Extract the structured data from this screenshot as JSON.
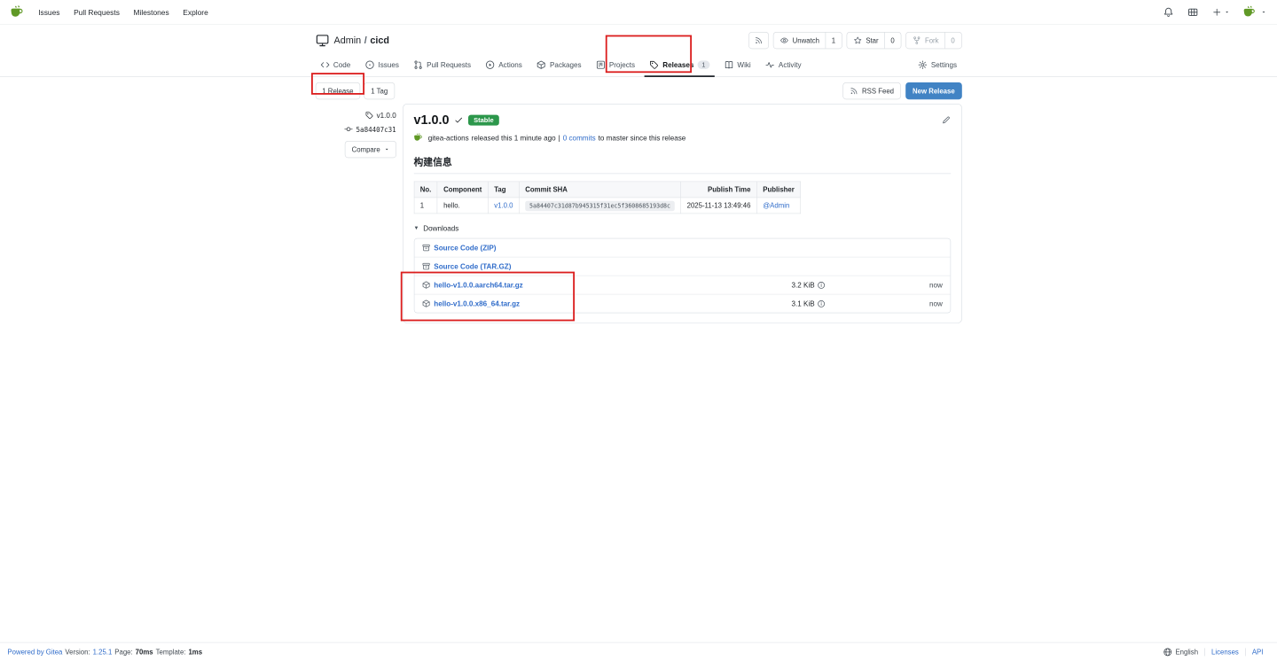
{
  "navbar": {
    "links": [
      "Issues",
      "Pull Requests",
      "Milestones",
      "Explore"
    ]
  },
  "repo": {
    "owner": "Admin",
    "separator": "/",
    "name": "cicd",
    "watch": {
      "label": "Unwatch",
      "count": "1"
    },
    "star": {
      "label": "Star",
      "count": "0"
    },
    "fork": {
      "label": "Fork",
      "count": "0"
    },
    "tabs": [
      {
        "label": "Code"
      },
      {
        "label": "Issues"
      },
      {
        "label": "Pull Requests"
      },
      {
        "label": "Actions"
      },
      {
        "label": "Packages"
      },
      {
        "label": "Projects"
      },
      {
        "label": "Releases",
        "count": "1"
      },
      {
        "label": "Wiki"
      },
      {
        "label": "Activity"
      },
      {
        "label": "Settings"
      }
    ]
  },
  "toolbar": {
    "releases_filter": "1 Release",
    "tags_filter": "1 Tag",
    "rss_feed": "RSS Feed",
    "new_release": "New Release"
  },
  "release_meta": {
    "tag": "v1.0.0",
    "commit": "5a84407c31",
    "compare_label": "Compare"
  },
  "release": {
    "title": "v1.0.0",
    "stability_badge": "Stable",
    "byline": {
      "author": "gitea-actions",
      "released_text": "released this 1 minute ago",
      "separator": "|",
      "commits_link": "0 commits",
      "suffix": "to master since this release"
    },
    "section_heading": "构建信息",
    "table": {
      "headers": [
        "No.",
        "Component",
        "Tag",
        "Commit SHA",
        "Publish Time",
        "Publisher"
      ],
      "rows": [
        [
          "1",
          "hello.",
          "v1.0.0",
          "5a84407c31d87b945315f31ec5f3608685193d8c",
          "2025-11-13 13:49:46",
          "@Admin"
        ]
      ]
    },
    "downloads_label": "Downloads",
    "downloads": [
      {
        "name": "Source Code (ZIP)"
      },
      {
        "name": "Source Code (TAR.GZ)"
      },
      {
        "name": "hello-v1.0.0.aarch64.tar.gz",
        "size": "3.2 KiB",
        "time": "now"
      },
      {
        "name": "hello-v1.0.0.x86_64.tar.gz",
        "size": "3.1 KiB",
        "time": "now"
      }
    ]
  },
  "footer": {
    "powered": "Powered by Gitea",
    "version_label": "Version:",
    "version": "1.25.1",
    "page_label": "Page:",
    "page_time": "70ms",
    "template_label": "Template:",
    "template_time": "1ms",
    "language": "English",
    "licenses": "Licenses",
    "api": "API"
  },
  "icons": {
    "downloads_caret": "▼",
    "compare_caret": "▾"
  },
  "colors": {
    "primary_button": "#4183c4",
    "link": "#316dca",
    "stable_badge": "#2c974b",
    "logo_green": "#609926",
    "annotation_red": "#db1d1d"
  }
}
